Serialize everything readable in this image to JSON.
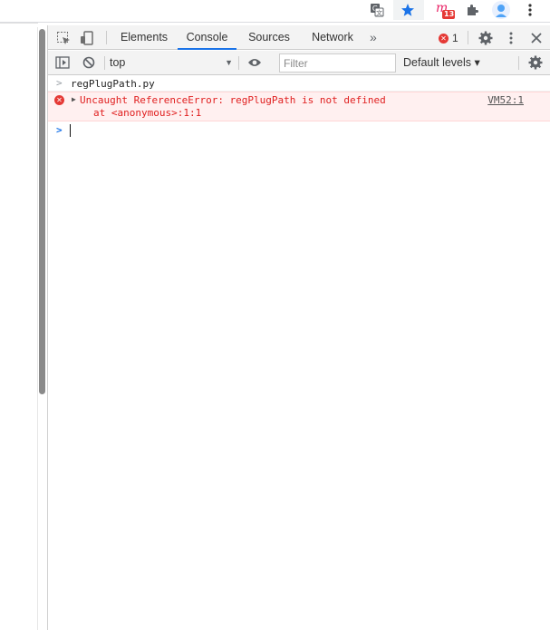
{
  "browser": {
    "extensions": [
      {
        "name": "translate-icon"
      },
      {
        "name": "star-icon"
      },
      {
        "name": "m-extension-icon",
        "badge": "13"
      },
      {
        "name": "puzzle-icon"
      },
      {
        "name": "profile-avatar-icon"
      },
      {
        "name": "kebab-menu-icon"
      }
    ]
  },
  "devtools": {
    "tabs": [
      {
        "label": "Elements"
      },
      {
        "label": "Console"
      },
      {
        "label": "Sources"
      },
      {
        "label": "Network"
      }
    ],
    "active_tab": "Console",
    "more_tabs": "»",
    "error_count": "1",
    "toolbar": {
      "context": "top",
      "filter_placeholder": "Filter",
      "levels": "Default levels ▾"
    },
    "console": {
      "command": "regPlugPath.py",
      "error_line1": "Uncaught ReferenceError: regPlugPath is not defined",
      "error_line2": "at <anonymous>:1:1",
      "error_source": "VM52:1"
    }
  },
  "colors": {
    "accent": "#1a73e8",
    "error": "#e53935",
    "error_bg": "#fff0f0"
  }
}
